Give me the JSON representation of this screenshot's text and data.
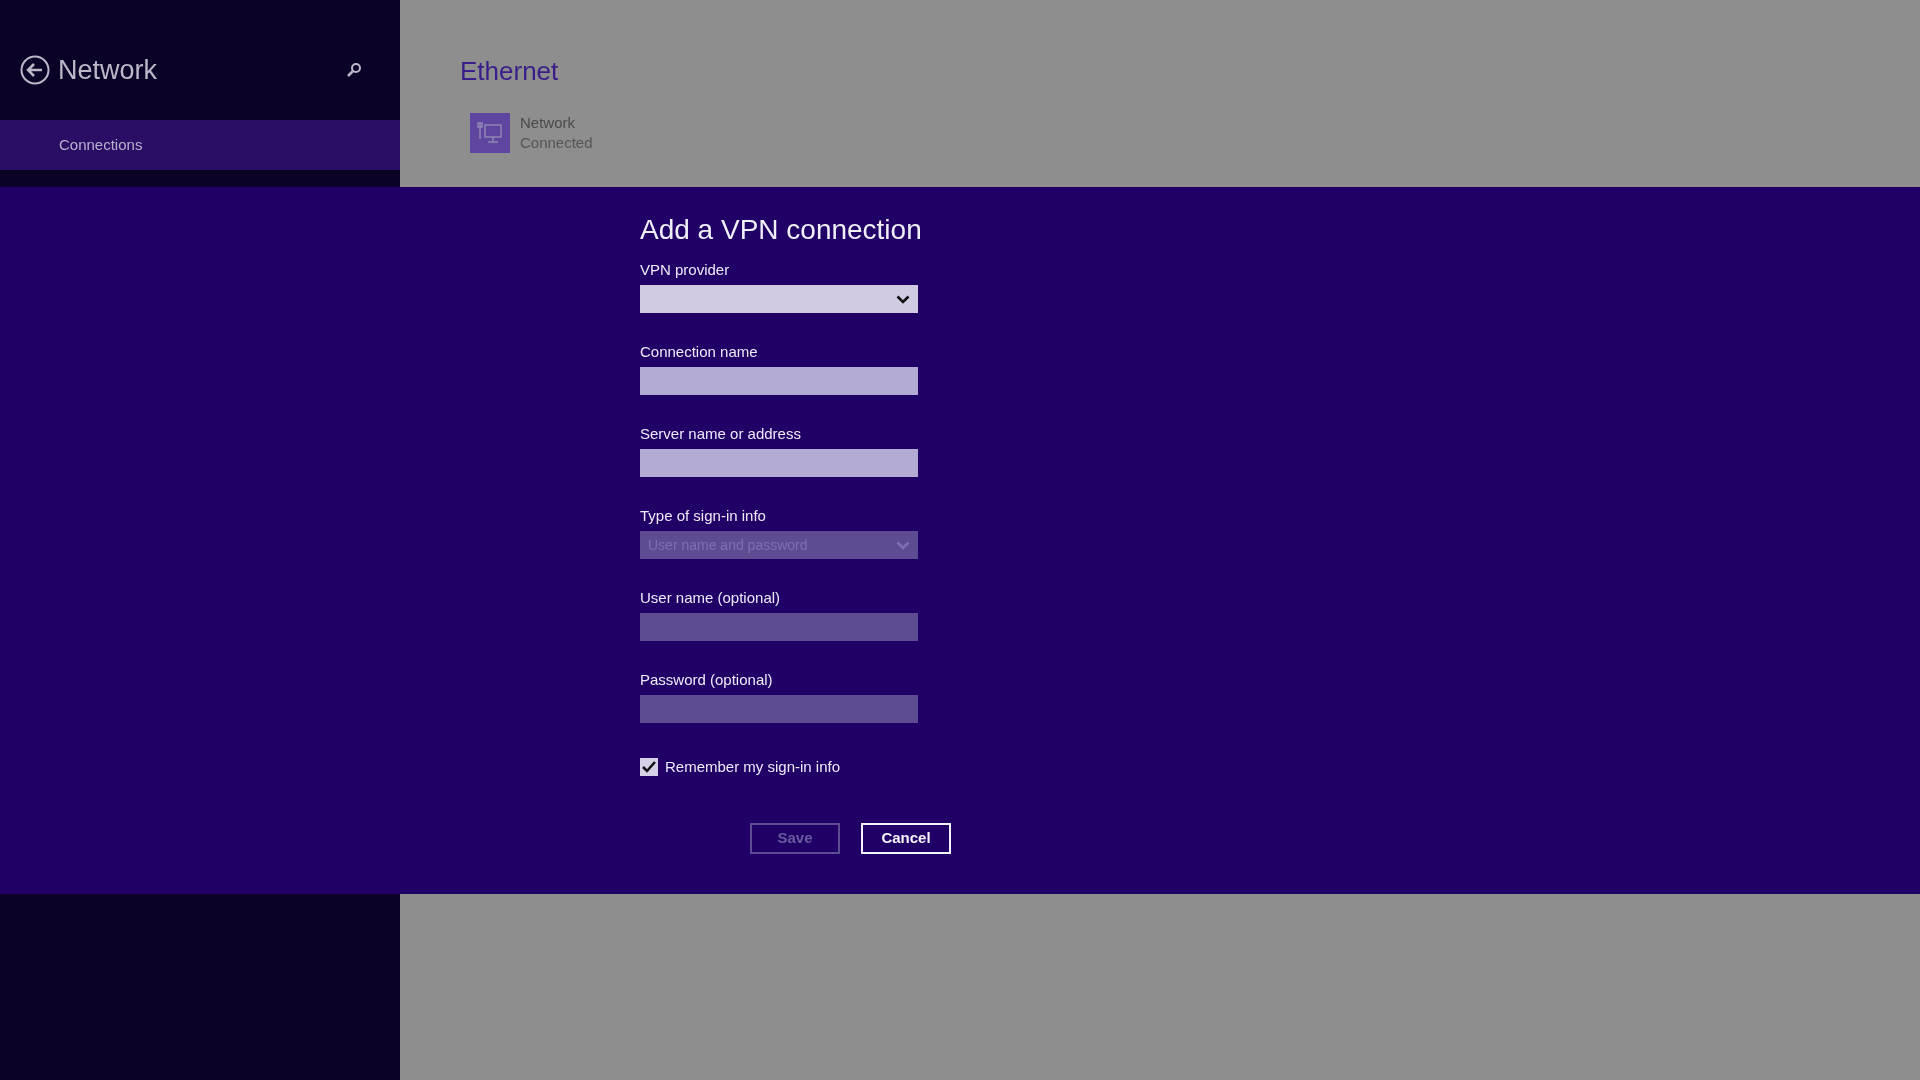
{
  "sidebar": {
    "title": "Network",
    "items": [
      {
        "label": "Connections",
        "selected": true
      }
    ]
  },
  "main": {
    "title": "Ethernet",
    "connections": [
      {
        "name": "Network",
        "status": "Connected"
      }
    ]
  },
  "dialog": {
    "title": "Add a VPN connection",
    "fields": [
      {
        "label": "VPN provider",
        "kind": "dropdown",
        "disabled": false,
        "emphasis": true
      },
      {
        "label": "Connection name",
        "kind": "text",
        "disabled": false
      },
      {
        "label": "Server name or address",
        "kind": "text",
        "disabled": false
      },
      {
        "label": "Type of sign-in info",
        "kind": "dropdown",
        "disabled": true,
        "value": "User name and password"
      },
      {
        "label": "User name (optional)",
        "kind": "text",
        "disabled": true
      },
      {
        "label": "Password (optional)",
        "kind": "text",
        "disabled": true
      }
    ],
    "remember": {
      "label": "Remember my sign-in info",
      "checked": true
    },
    "buttons": [
      {
        "label": "Save",
        "disabled": true
      },
      {
        "label": "Cancel",
        "disabled": false
      }
    ]
  }
}
